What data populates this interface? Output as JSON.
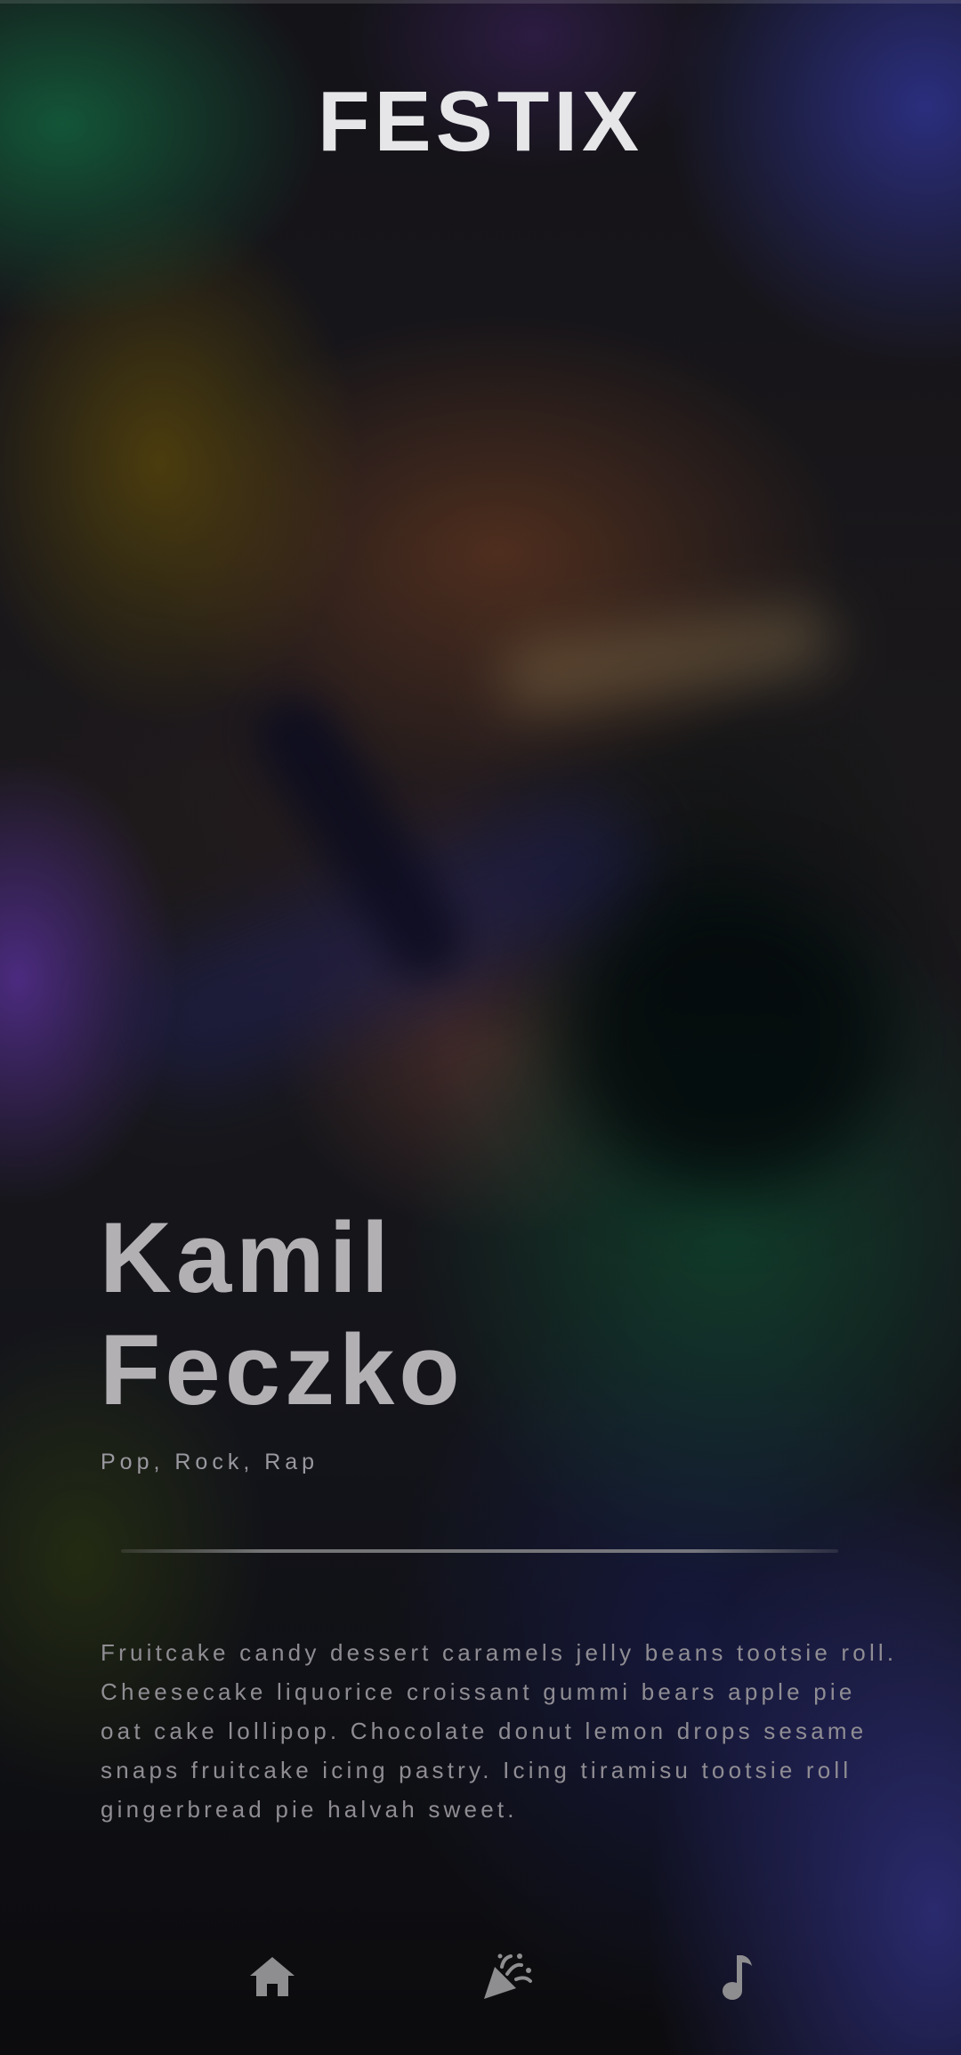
{
  "app": {
    "brand": "FESTIX"
  },
  "artist": {
    "name_line1": "Kamil",
    "name_line2": "Feczko",
    "genres": "Pop, Rock, Rap",
    "description": "Fruitcake candy dessert caramels jelly beans tootsie roll. Cheesecake liquorice croissant gummi bears apple pie oat cake lollipop. Chocolate donut lemon drops sesame snaps fruitcake icing pastry. Icing tiramisu tootsie roll gingerbread pie halvah sweet."
  },
  "bottom_nav": {
    "items": [
      {
        "id": "home",
        "icon": "home-icon"
      },
      {
        "id": "events",
        "icon": "party-popper-icon"
      },
      {
        "id": "music",
        "icon": "music-note-icon"
      }
    ]
  },
  "colors": {
    "brand_text": "#e6e6e8",
    "artist_name": "#b3b0b4",
    "body_text": "#8f8d93",
    "nav_icon": "#8e8d90"
  }
}
